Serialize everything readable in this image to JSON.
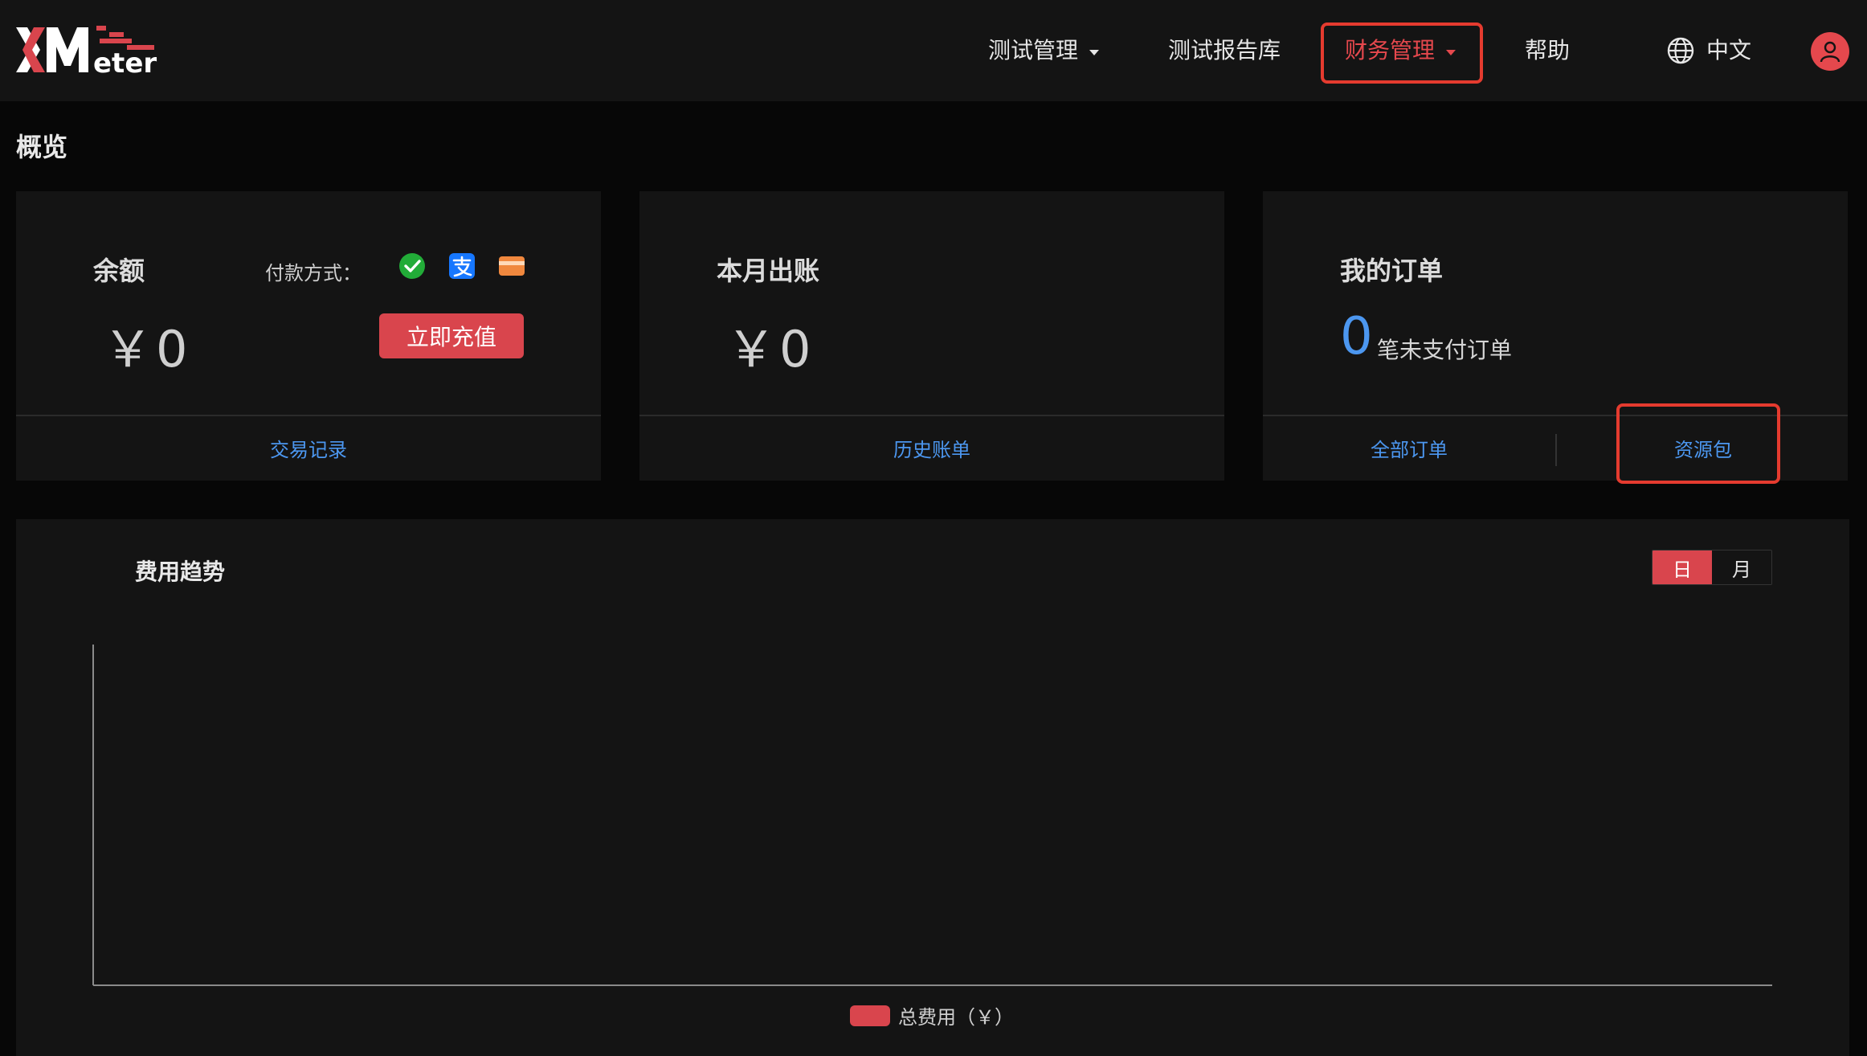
{
  "header": {
    "logo_text": "XMeter",
    "nav": [
      {
        "label": "测试管理",
        "has_dropdown": true
      },
      {
        "label": "测试报告库",
        "has_dropdown": false
      },
      {
        "label": "财务管理",
        "has_dropdown": true,
        "active": true
      },
      {
        "label": "帮助",
        "has_dropdown": false
      }
    ],
    "language": "中文",
    "accent_color": "#e5484d"
  },
  "page": {
    "title": "概览"
  },
  "balance_card": {
    "title": "余额",
    "amount": "￥0",
    "payment_label": "付款方式：",
    "payment_icons": [
      "wechat-pay-icon",
      "alipay-icon",
      "bank-card-icon"
    ],
    "recharge_label": "立即充值",
    "link": "交易记录"
  },
  "bill_card": {
    "title": "本月出账",
    "amount": "￥0",
    "link": "历史账单"
  },
  "orders_card": {
    "title": "我的订单",
    "count": "0",
    "count_suffix": "笔未支付订单",
    "link_all": "全部订单",
    "link_resource": "资源包"
  },
  "chart_panel": {
    "title": "费用趋势",
    "toggle": [
      {
        "label": "日",
        "active": true
      },
      {
        "label": "月",
        "active": false
      }
    ]
  },
  "chart_data": {
    "type": "bar",
    "categories": [],
    "series": [
      {
        "name": "总费用（￥）",
        "values": [],
        "color": "#d9454d"
      }
    ],
    "title": "费用趋势",
    "xlabel": "",
    "ylabel": "",
    "legend": "bottom-center",
    "grid": false
  }
}
